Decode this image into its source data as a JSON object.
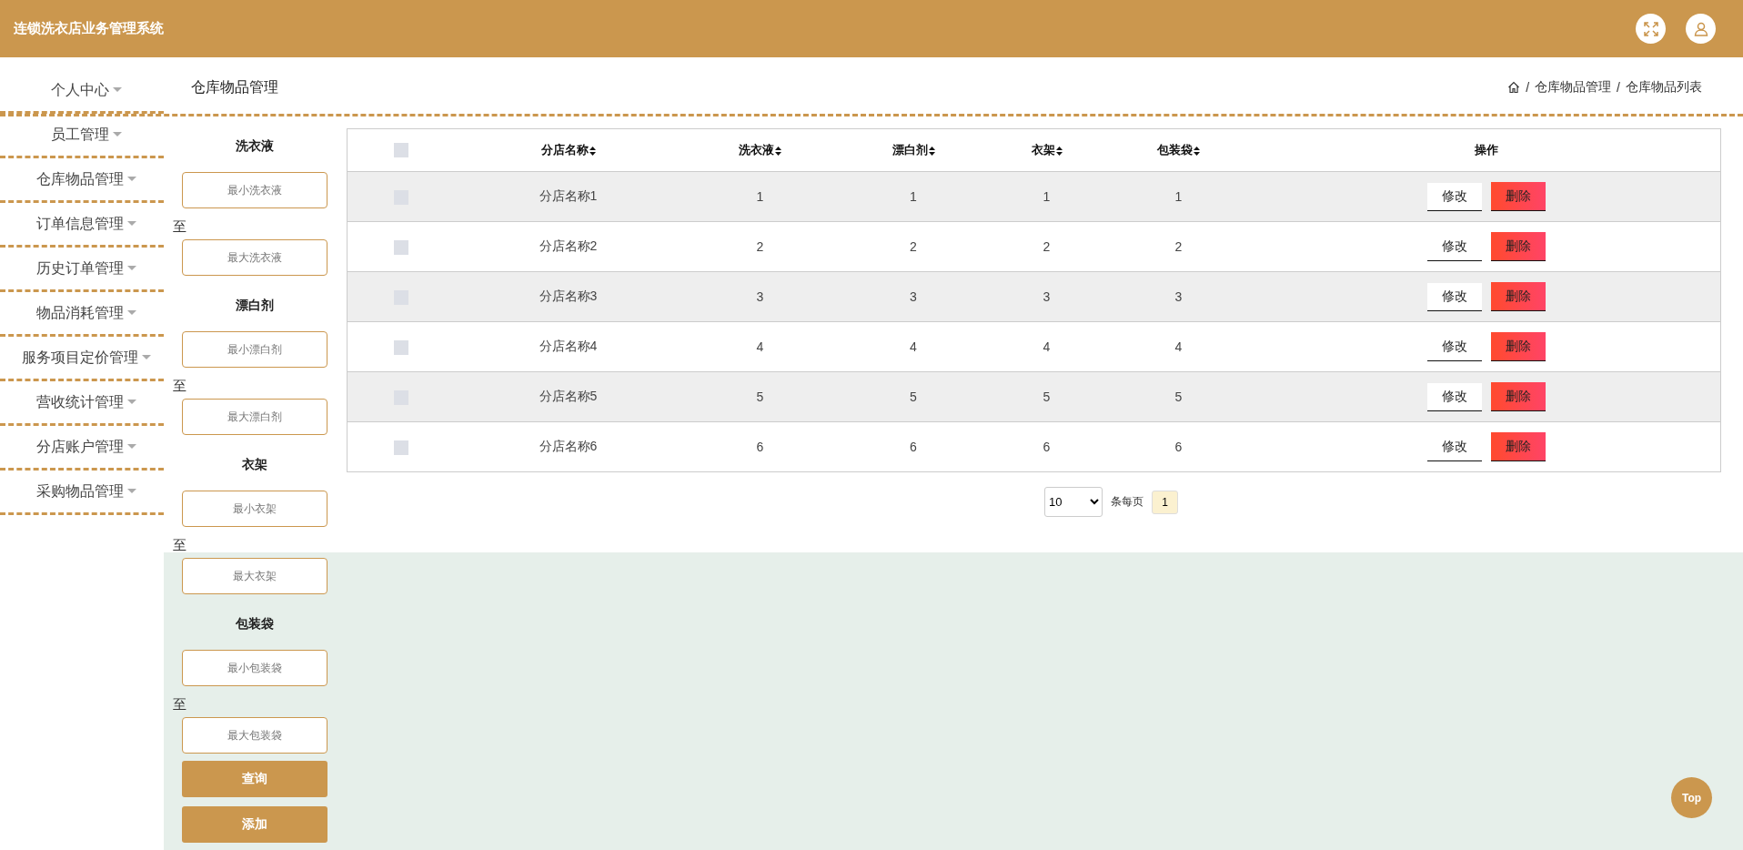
{
  "header": {
    "title": "连锁洗衣店业务管理系统"
  },
  "sidebar": {
    "items": [
      {
        "label": "个人中心",
        "selected": false
      },
      {
        "label": "员工管理",
        "selected": false
      },
      {
        "label": "仓库物品管理",
        "selected": false
      },
      {
        "label": "订单信息管理",
        "selected": false
      },
      {
        "label": "历史订单管理",
        "selected": false
      },
      {
        "label": "物品消耗管理",
        "selected": false
      },
      {
        "label": "服务项目定价管理",
        "selected": false
      },
      {
        "label": "营收统计管理",
        "selected": false
      },
      {
        "label": "分店账户管理",
        "selected": false
      },
      {
        "label": "采购物品管理",
        "selected": false
      }
    ]
  },
  "page_title": "仓库物品管理",
  "breadcrumb": [
    {
      "separator": "/",
      "label": "仓库物品管理"
    },
    {
      "separator": "/",
      "label": "仓库物品列表"
    }
  ],
  "filters": [
    {
      "label": "洗衣液",
      "min_placeholder": "最小洗衣液",
      "to": "至",
      "max_placeholder": "最大洗衣液"
    },
    {
      "label": "漂白剂",
      "min_placeholder": "最小漂白剂",
      "to": "至",
      "max_placeholder": "最大漂白剂"
    },
    {
      "label": "衣架",
      "min_placeholder": "最小衣架",
      "to": "至",
      "max_placeholder": "最大衣架"
    },
    {
      "label": "包装袋",
      "min_placeholder": "最小包装袋",
      "to": "至",
      "max_placeholder": "最大包装袋"
    }
  ],
  "buttons": {
    "search": "查询",
    "add": "添加"
  },
  "table": {
    "select_all_checked": false,
    "columns": [
      {
        "label": "分店名称",
        "sortable": true
      },
      {
        "label": "洗衣液",
        "sortable": true
      },
      {
        "label": "漂白剂",
        "sortable": true
      },
      {
        "label": "衣架",
        "sortable": true
      },
      {
        "label": "包装袋",
        "sortable": true
      },
      {
        "label": "操作",
        "sortable": false
      }
    ],
    "rows": [
      {
        "selected": false,
        "cells": [
          "分店名称1",
          "1",
          "1",
          "1",
          "1"
        ],
        "edit": "修改",
        "delete": "删除"
      },
      {
        "selected": false,
        "cells": [
          "分店名称2",
          "2",
          "2",
          "2",
          "2"
        ],
        "edit": "修改",
        "delete": "删除"
      },
      {
        "selected": false,
        "cells": [
          "分店名称3",
          "3",
          "3",
          "3",
          "3"
        ],
        "edit": "修改",
        "delete": "删除"
      },
      {
        "selected": false,
        "cells": [
          "分店名称4",
          "4",
          "4",
          "4",
          "4"
        ],
        "edit": "修改",
        "delete": "删除"
      },
      {
        "selected": false,
        "cells": [
          "分店名称5",
          "5",
          "5",
          "5",
          "5"
        ],
        "edit": "修改",
        "delete": "删除"
      },
      {
        "selected": false,
        "cells": [
          "分店名称6",
          "6",
          "6",
          "6",
          "6"
        ],
        "edit": "修改",
        "delete": "删除"
      }
    ]
  },
  "pagination": {
    "page_size": "10",
    "per_page_label": "条每页",
    "pages": [
      {
        "label": "1",
        "selected": true
      }
    ]
  },
  "top_button": "Top"
}
